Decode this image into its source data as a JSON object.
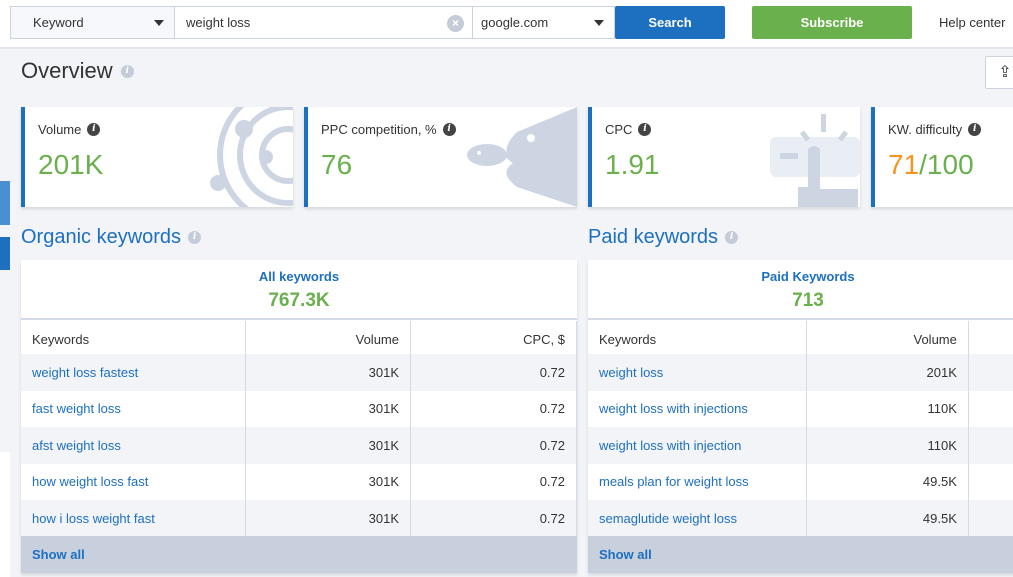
{
  "search": {
    "type_label": "Keyword",
    "query": "weight loss",
    "engine": "google.com",
    "search_label": "Search",
    "subscribe_label": "Subscribe",
    "help_label": "Help center"
  },
  "overview": {
    "title": "Overview",
    "cards": [
      {
        "label": "Volume",
        "value": "201K"
      },
      {
        "label": "PPC competition, %",
        "value": "76"
      },
      {
        "label": "CPC",
        "value": "1.91"
      },
      {
        "label": "KW. difficulty",
        "value": "71",
        "value_max": "/100"
      }
    ]
  },
  "organic": {
    "title": "Organic keywords",
    "summary_label": "All keywords",
    "summary_value": "767.3K",
    "columns": [
      "Keywords",
      "Volume",
      "CPC, $"
    ],
    "rows": [
      [
        "weight loss fastest",
        "301K",
        "0.72"
      ],
      [
        "fast weight loss",
        "301K",
        "0.72"
      ],
      [
        "afst weight loss",
        "301K",
        "0.72"
      ],
      [
        "how weight loss fast",
        "301K",
        "0.72"
      ],
      [
        "how i loss weight fast",
        "301K",
        "0.72"
      ]
    ],
    "show_all": "Show all"
  },
  "paid": {
    "title": "Paid keywords",
    "summary_label": "Paid Keywords",
    "summary_value": "713",
    "columns": [
      "Keywords",
      "Volume"
    ],
    "rows": [
      [
        "weight loss",
        "201K"
      ],
      [
        "weight loss with injections",
        "110K"
      ],
      [
        "weight loss with injection",
        "110K"
      ],
      [
        "meals plan for weight loss",
        "49.5K"
      ],
      [
        "semaglutide weight loss",
        "49.5K"
      ]
    ],
    "show_all": "Show all"
  },
  "colors": {
    "accent": "#1d6fc0",
    "green": "#6ab04c",
    "orange": "#f7941d",
    "subscribe": "#6ab04c"
  }
}
